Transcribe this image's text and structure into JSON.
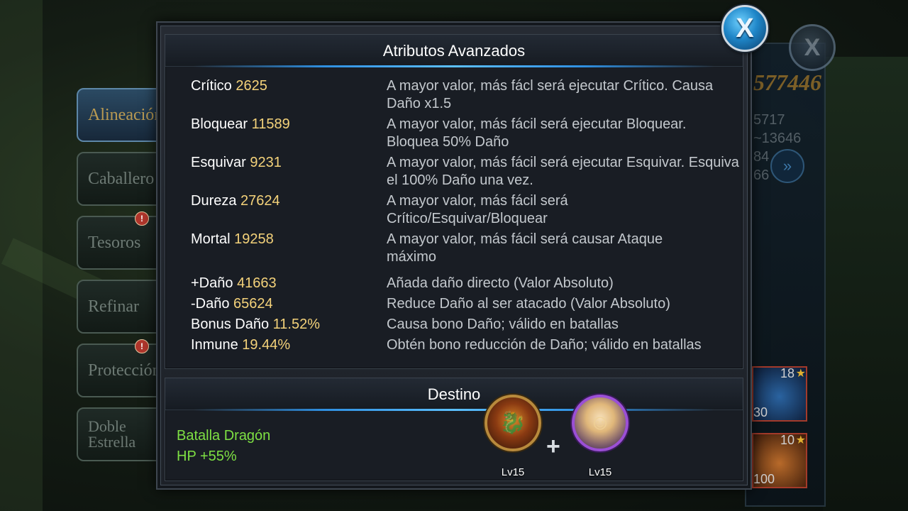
{
  "background": {
    "side_tabs": [
      {
        "label": "Alineación",
        "active": true,
        "alert": false
      },
      {
        "label": "Caballero",
        "active": false,
        "alert": false
      },
      {
        "label": "Tesoros",
        "active": false,
        "alert": true
      },
      {
        "label": "Refinar",
        "active": false,
        "alert": false
      },
      {
        "label": "Protección",
        "active": false,
        "alert": true
      },
      {
        "label": "Doble Estrella",
        "active": false,
        "alert": false
      }
    ],
    "alert_glyph": "!",
    "power_value": "577446",
    "stat_line_1": "5717",
    "stat_line_2": "~13646",
    "stat_line_3": "84",
    "stat_line_4": "66",
    "item_1": {
      "count": "18",
      "sub": "30"
    },
    "item_2": {
      "count": "10",
      "sub": "100"
    },
    "close_glyph": "X",
    "arrow_glyph": "»"
  },
  "dialog": {
    "close_glyph": "X",
    "attributes": {
      "title": "Atributos Avanzados",
      "rows": [
        {
          "name": "Crítico",
          "value": "2625",
          "desc": "A mayor valor, más fácl será ejecutar Crítico. Causa Daño x1.5"
        },
        {
          "name": "Bloquear",
          "value": "11589",
          "desc": "A mayor valor, más fácil será ejecutar Bloquear. Bloquea 50% Daño"
        },
        {
          "name": "Esquivar",
          "value": "9231",
          "desc": "A mayor valor, más fácil será ejecutar Esquivar. Esquiva el 100% Daño una vez."
        },
        {
          "name": "Dureza",
          "value": "27624",
          "desc": "A mayor valor, más fácil será Crítico/Esquivar/Bloquear"
        },
        {
          "name": "Mortal",
          "value": "19258",
          "desc": "A mayor valor, más fácil será causar Ataque máximo"
        },
        {
          "name": "+Daño",
          "value": "41663",
          "desc": "Añada daño directo (Valor Absoluto)"
        },
        {
          "name": "-Daño",
          "value": "65624",
          "desc": "Reduce Daño al ser atacado (Valor Absoluto)"
        },
        {
          "name": "Bonus Daño",
          "value": "11.52%",
          "desc": "Causa bono Daño; válido en batallas"
        },
        {
          "name": "Inmune",
          "value": "19.44%",
          "desc": "Obtén bono reducción de Daño; válido en batallas"
        }
      ]
    },
    "destiny": {
      "title": "Destino",
      "name": "Batalla Dragón",
      "bonus": "HP +55%",
      "plus": "+",
      "heroes": [
        {
          "name": "dragon",
          "level": "Lv15"
        },
        {
          "name": "elf",
          "level": "Lv15"
        }
      ]
    }
  },
  "colors": {
    "value_gold": "#f4d27a",
    "destiny_green": "#7ee043",
    "accent_blue": "#2f8fe0"
  }
}
